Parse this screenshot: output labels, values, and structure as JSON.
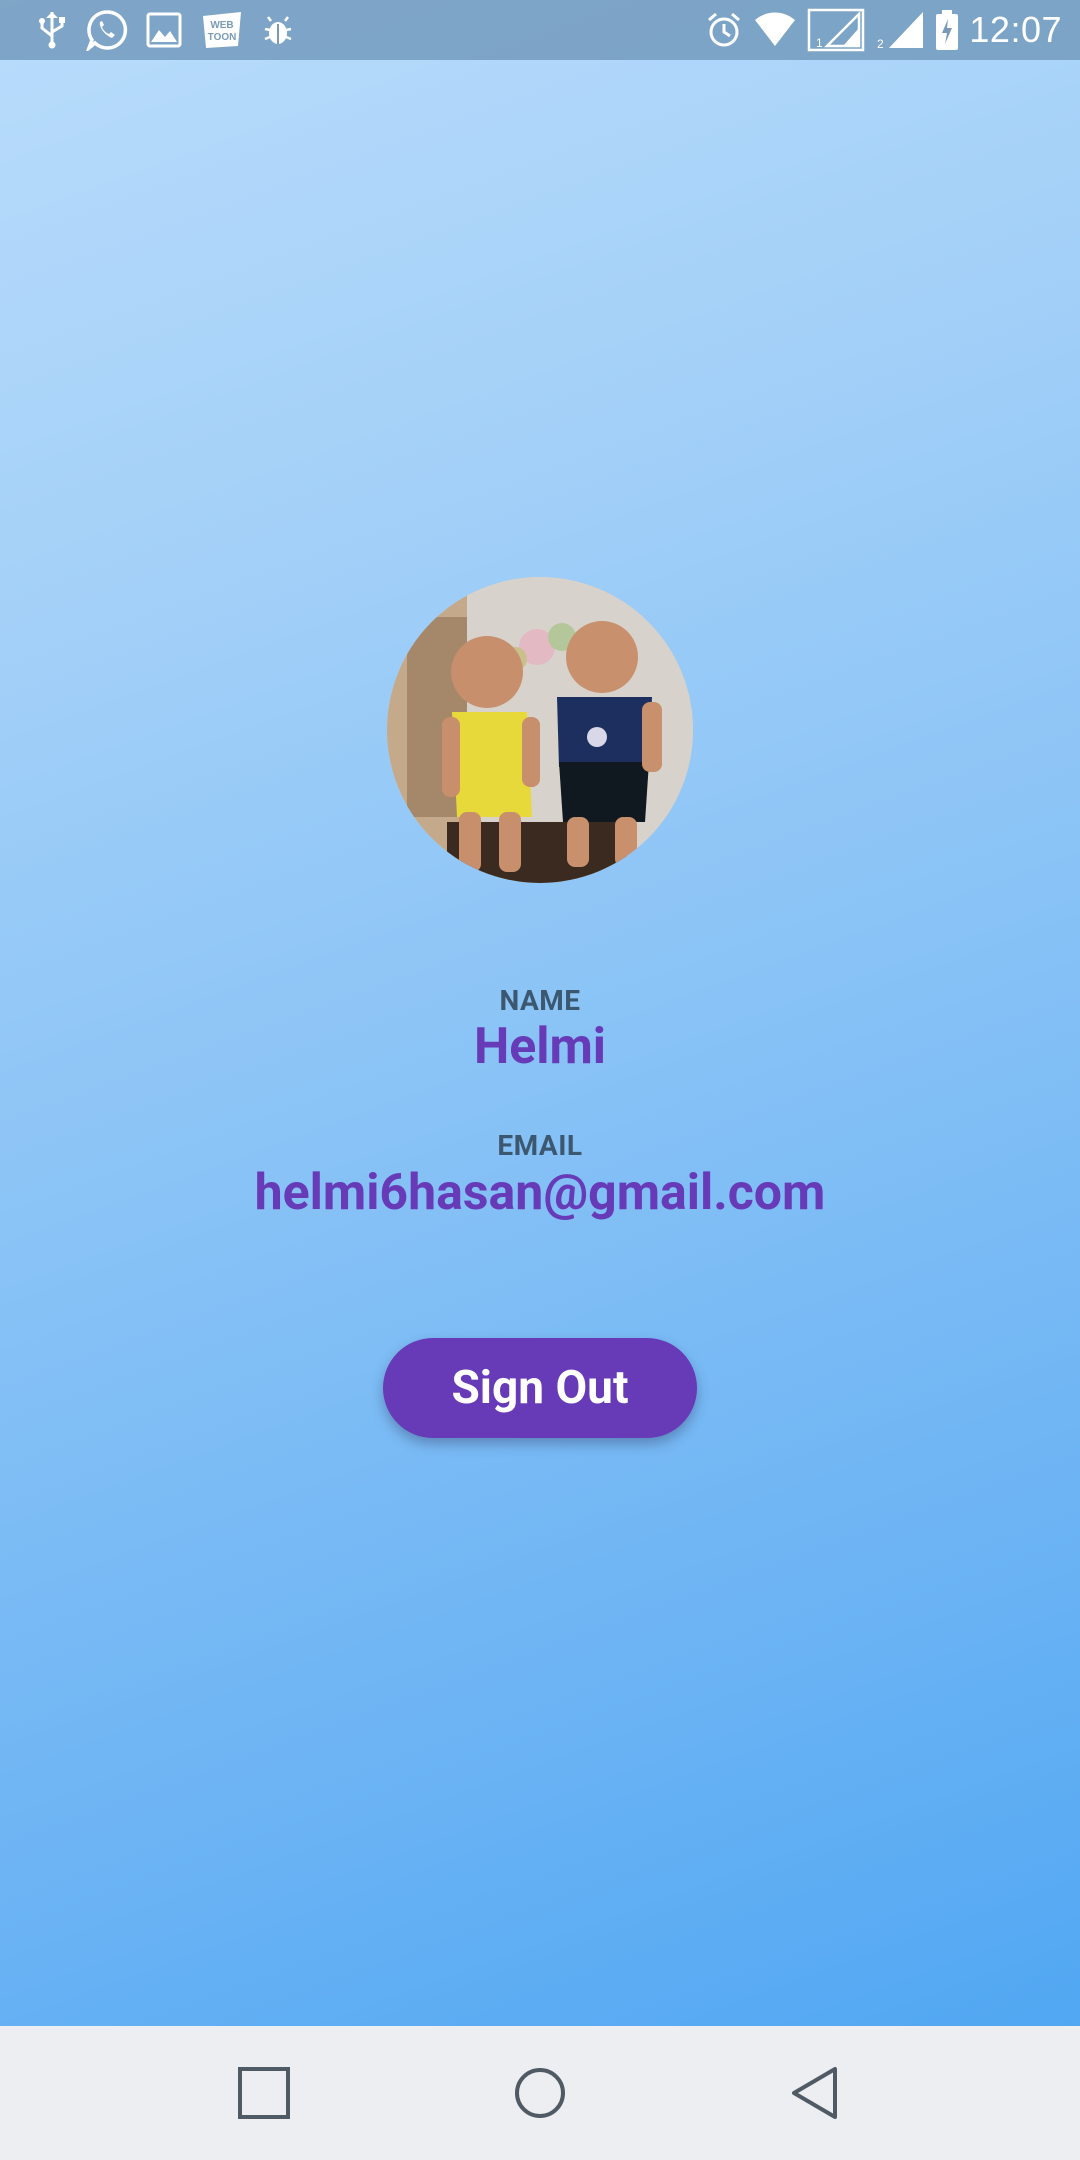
{
  "status_bar": {
    "time": "12:07",
    "left_icons": [
      "usb-icon",
      "whatsapp-icon",
      "gallery-icon",
      "webtoon-icon",
      "bug-icon"
    ],
    "webtoon_logo_text": "WEB TOON",
    "right_icons": [
      "alarm-icon",
      "wifi-icon",
      "signal-sim1-icon",
      "signal-sim2-icon",
      "battery-icon"
    ]
  },
  "profile": {
    "avatar_alt": "profile-photo",
    "name_label": "NAME",
    "name": "Helmi",
    "email_label": "EMAIL",
    "email": "helmi6hasan@gmail.com"
  },
  "actions": {
    "sign_out_label": "Sign Out"
  },
  "nav_bar": {
    "items": [
      "recent-apps",
      "home",
      "back"
    ]
  },
  "colors": {
    "accent": "#673ab7",
    "label": "#3c5870",
    "gradient_top": "#b9dcfb",
    "gradient_bottom": "#4aa4f2",
    "nav_bg": "#eceef1"
  }
}
